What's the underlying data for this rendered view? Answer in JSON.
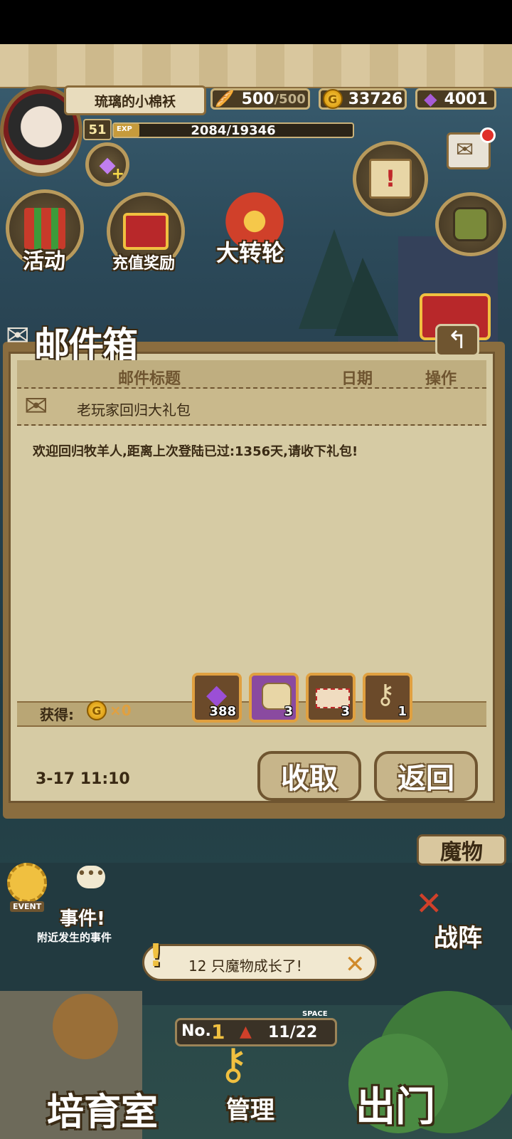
{
  "player": {
    "name": "琉璃的小棉袄",
    "level": "51",
    "exp_label": "EXP",
    "exp_text": "2084/19346",
    "exp_fraction": 0.108
  },
  "resources": {
    "stamina": "500",
    "stamina_max": "/500",
    "gold": "33726",
    "gems": "4001"
  },
  "menu": {
    "activity": "活动",
    "recharge": "充值奖励",
    "wheel": "大转轮"
  },
  "mailbox": {
    "title": "邮件箱",
    "headers": {
      "subject": "邮件标题",
      "date": "日期",
      "action": "操作"
    },
    "subject": "老玩家回归大礼包",
    "body": "欢迎回归牧羊人,距离上次登陆已过:1356天,请收下礼包!",
    "reward_label": "获得:",
    "coin_count": "×0",
    "items": [
      {
        "icon": "gem-icon",
        "count": "388"
      },
      {
        "icon": "scroll-pouch-icon",
        "count": "3"
      },
      {
        "icon": "ticket-icon",
        "count": "3"
      },
      {
        "icon": "key-icon",
        "count": "1"
      }
    ],
    "date": "3-17 11:10",
    "collect_label": "收取",
    "back_label": "返回"
  },
  "event": {
    "badge": "EVENT",
    "title": "事件!",
    "subtitle": "附近发生的事件"
  },
  "notification": {
    "text": "12 只魔物成长了!"
  },
  "rank": {
    "prefix": "No.",
    "number": "1",
    "space_label": "SPACE",
    "capacity": "11/22"
  },
  "side_tabs": {
    "monsters": "魔物",
    "formation": "战阵"
  },
  "bottom_tabs": {
    "nursery": "培育室",
    "manage": "管理",
    "exit": "出门"
  }
}
